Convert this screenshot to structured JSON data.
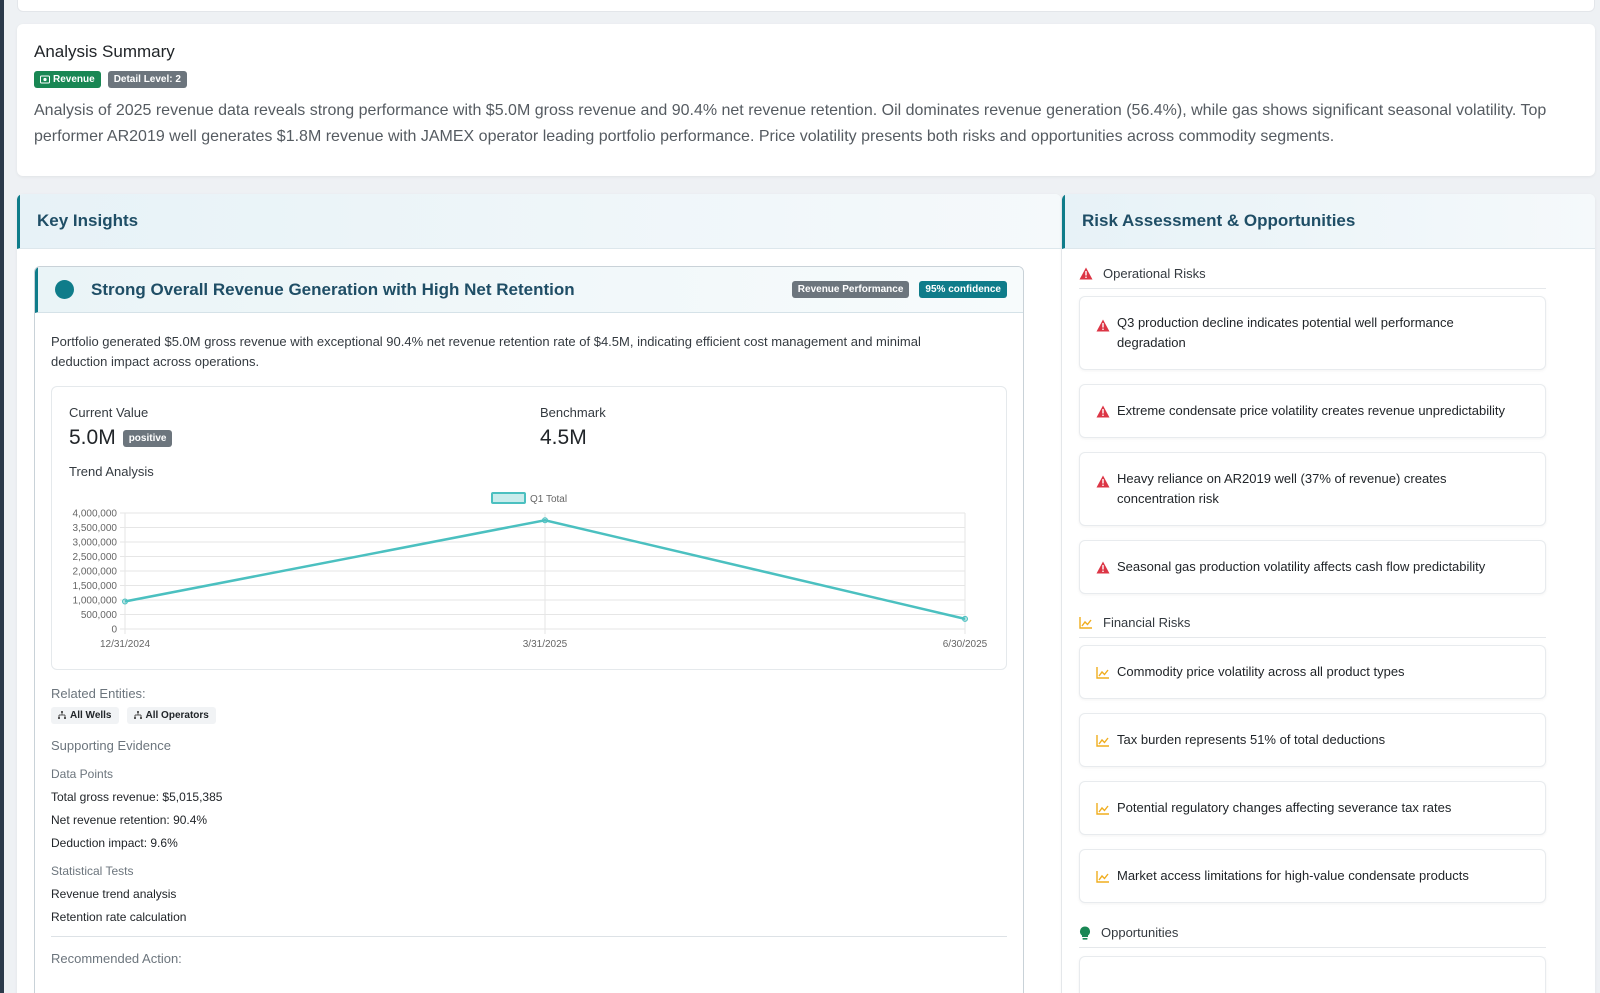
{
  "summary": {
    "title": "Analysis Summary",
    "badge_category": "Revenue",
    "badge_detail": "Detail Level: 2",
    "text": "Analysis of 2025 revenue data reveals strong performance with $5.0M gross revenue and 90.4% net revenue retention. Oil dominates revenue generation (56.4%), while gas shows significant seasonal volatility. Top performer AR2019 well generates $1.8M revenue with JAMEX operator leading portfolio performance. Price volatility presents both risks and opportunities across commodity segments."
  },
  "insights": {
    "header": "Key Insights",
    "item": {
      "title": "Strong Overall Revenue Generation with High Net Retention",
      "category": "Revenue Performance",
      "confidence": "95% confidence",
      "description": "Portfolio generated $5.0M gross revenue with exceptional 90.4% net revenue retention rate of $4.5M, indicating efficient cost management and minimal deduction impact across operations.",
      "current_label": "Current Value",
      "current_value": "5.0M",
      "current_badge": "positive",
      "benchmark_label": "Benchmark",
      "benchmark_value": "4.5M",
      "trend_label": "Trend Analysis",
      "related_label": "Related Entities:",
      "entities": [
        "All Wells",
        "All Operators"
      ],
      "evidence_label": "Supporting Evidence",
      "data_points_label": "Data Points",
      "data_points": [
        "Total gross revenue: $5,015,385",
        "Net revenue retention: 90.4%",
        "Deduction impact: 9.6%"
      ],
      "stat_tests_label": "Statistical Tests",
      "stat_tests": [
        "Revenue trend analysis",
        "Retention rate calculation"
      ],
      "action_label": "Recommended Action:"
    }
  },
  "chart_data": {
    "type": "line",
    "categories": [
      "12/31/2024",
      "3/31/2025",
      "6/30/2025"
    ],
    "series": [
      {
        "name": "Q1 Total",
        "values": [
          950000,
          3750000,
          350000
        ]
      }
    ],
    "ylim": [
      0,
      4000000
    ],
    "yticks": [
      "4,000,000",
      "3,500,000",
      "3,000,000",
      "2,500,000",
      "2,000,000",
      "1,500,000",
      "1,000,000",
      "500,000",
      "0"
    ],
    "legend": "top",
    "grid": true,
    "color": "#4bc0c0"
  },
  "risks": {
    "header": "Risk Assessment & Opportunities",
    "operational_label": "Operational Risks",
    "operational": [
      "Q3 production decline indicates potential well performance degradation",
      "Extreme condensate price volatility creates revenue unpredictability",
      "Heavy reliance on AR2019 well (37% of revenue) creates concentration risk",
      "Seasonal gas production volatility affects cash flow predictability"
    ],
    "financial_label": "Financial Risks",
    "financial": [
      "Commodity price volatility across all product types",
      "Tax burden represents 51% of total deductions",
      "Potential regulatory changes affecting severance tax rates",
      "Market access limitations for high-value condensate products"
    ],
    "opportunities_label": "Opportunities"
  },
  "colors": {
    "accent": "#0f7c8a",
    "danger": "#dc3545",
    "warning": "#f0ad1e",
    "success": "#198754"
  }
}
